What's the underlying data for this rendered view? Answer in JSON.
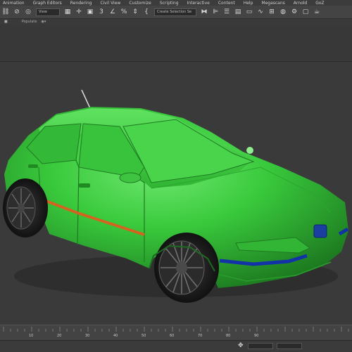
{
  "menu": {
    "items": [
      "Animation",
      "Graph Editors",
      "Rendering",
      "Civil View",
      "Customize",
      "Scripting",
      "Interactive",
      "Content",
      "Help",
      "Megascans",
      "Arnold",
      "GoZ"
    ]
  },
  "toolbar": {
    "view_dropdown": "View",
    "selection_set_dropdown": "Create Selection Se",
    "snap_label": "3",
    "percent_label": "%"
  },
  "ribbon": {
    "tab": "Populate"
  },
  "timeline": {
    "tick_labels": [
      "10",
      "20",
      "30",
      "40",
      "50",
      "60",
      "70",
      "80",
      "90"
    ]
  },
  "statusbar": {
    "field_x": "",
    "field_y": ""
  },
  "colors": {
    "car_body": "#39c93c",
    "trim_orange": "#d4631f",
    "trim_blue": "#1432a8",
    "viewport_bg": "#3a3a3a"
  }
}
